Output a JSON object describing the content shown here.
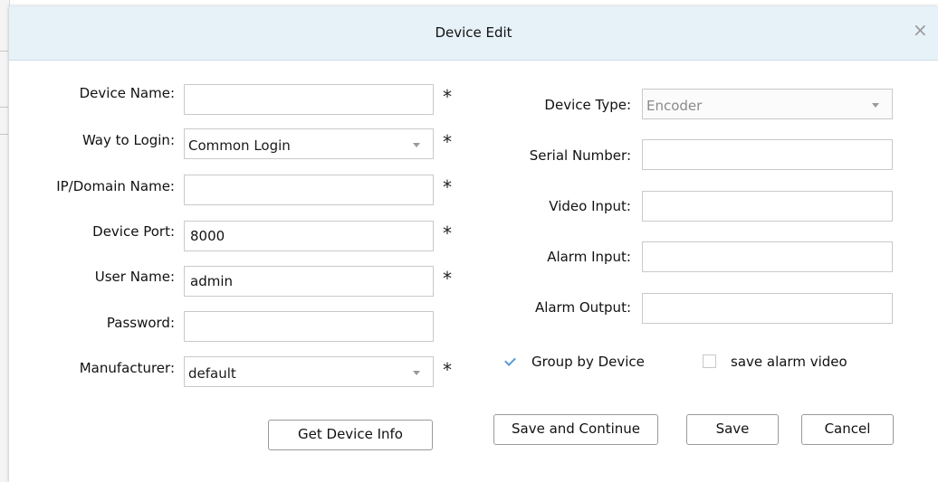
{
  "dialog": {
    "title": "Device Edit",
    "close_glyph": "×"
  },
  "form": {
    "device_name": {
      "label": "Device Name:",
      "value": ""
    },
    "way_to_login": {
      "label": "Way to Login:",
      "value": "Common Login"
    },
    "ip_domain": {
      "label": "IP/Domain Name:",
      "value": ""
    },
    "device_port": {
      "label": "Device Port:",
      "value": "8000"
    },
    "user_name": {
      "label": "User Name:",
      "value": "admin"
    },
    "password": {
      "label": "Password:",
      "value": ""
    },
    "manufacturer": {
      "label": "Manufacturer:",
      "value": "default"
    },
    "device_type": {
      "label": "Device Type:",
      "value": "Encoder"
    },
    "serial_number": {
      "label": "Serial Number:",
      "value": ""
    },
    "video_input": {
      "label": "Video Input:",
      "value": ""
    },
    "alarm_input": {
      "label": "Alarm Input:",
      "value": ""
    },
    "alarm_output": {
      "label": "Alarm Output:",
      "value": ""
    },
    "required_mark": "*"
  },
  "options": {
    "group_by_device": {
      "label": "Group by Device",
      "checked": true
    },
    "save_alarm_video": {
      "label": "save alarm video",
      "checked": false
    }
  },
  "buttons": {
    "get_device_info": "Get Device Info",
    "save_and_continue": "Save and Continue",
    "save": "Save",
    "cancel": "Cancel"
  },
  "icons": {
    "dropdown": "chevron-down-icon",
    "close": "close-icon",
    "check": "check-icon"
  },
  "colors": {
    "titlebar_bg": "#e6f1f8",
    "check_accent": "#5a9bd4"
  }
}
